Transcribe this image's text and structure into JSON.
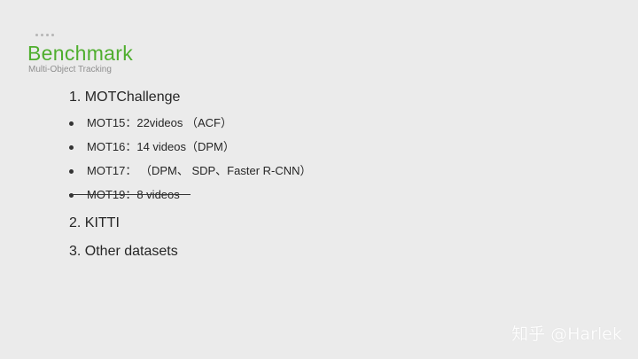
{
  "colors": {
    "accent": "#4fae2e",
    "background": "#ebebeb",
    "text": "#262626",
    "muted": "#8f8f8f"
  },
  "header": {
    "title": "Benchmark",
    "subtitle": "Multi-Object Tracking"
  },
  "content": {
    "h1": "1.   MOTChallenge",
    "bullets": [
      "MOT15：22videos （ACF）",
      "MOT16：14 videos（DPM）",
      "MOT17：   （DPM、 SDP、Faster R-CNN）",
      "MOT19：8 videos"
    ],
    "h2": "2. KITTI",
    "h3": "3. Other datasets"
  },
  "watermark": "知乎 @Harlek"
}
